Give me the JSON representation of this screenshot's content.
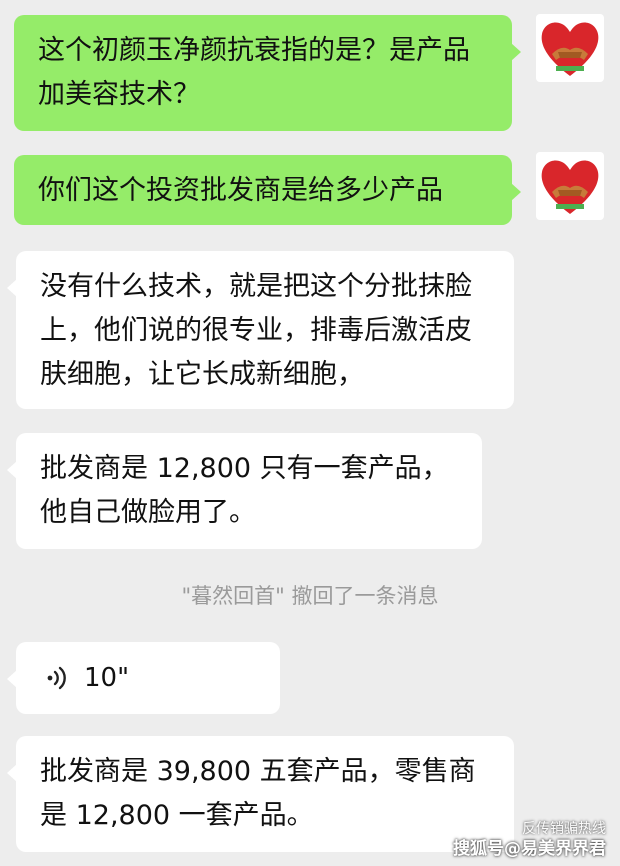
{
  "messages": [
    {
      "side": "out",
      "text": "这个初颜玉净颜抗衰指的是？是产品加美容技术？"
    },
    {
      "side": "out",
      "text": "你们这个投资批发商是给多少产品"
    },
    {
      "side": "in",
      "text": "没有什么技术，就是把这个分批抹脸上，他们说的很专业，排毒后激活皮肤细胞，让它长成新细胞，"
    },
    {
      "side": "in",
      "text": "批发商是 12,800 只有一套产品，他自己做脸用了。"
    },
    {
      "side": "in",
      "text": "批发商是 39,800 五套产品，零售商是 12,800 一套产品。"
    }
  ],
  "recall_notice": "\"暮然回首\" 撤回了一条消息",
  "voice": {
    "duration": "10\"",
    "icon": "voice-wave-icon"
  },
  "avatar_icon": "heart-handshake-avatar-icon",
  "watermark": {
    "top": "反传销骗热线",
    "bottom": "搜狐号@易美界界君"
  },
  "colors": {
    "background": "#ededed",
    "outgoing_bubble": "#95ec69",
    "incoming_bubble": "#ffffff",
    "recall_text": "#9a9a9a"
  }
}
